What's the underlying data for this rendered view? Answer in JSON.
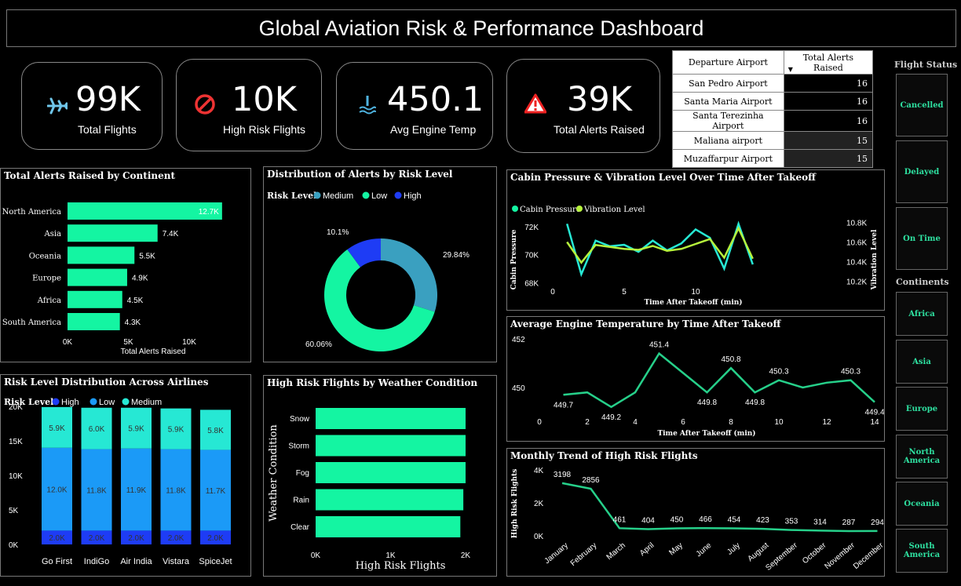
{
  "title": "Global Aviation Risk & Performance Dashboard",
  "kpis": [
    {
      "value": "99K",
      "label": "Total Flights",
      "icon": "airplane-icon"
    },
    {
      "value": "10K",
      "label": "High Risk Flights",
      "icon": "prohibited-icon"
    },
    {
      "value": "450.1",
      "label": "Avg Engine Temp",
      "icon": "thermometer-icon"
    },
    {
      "value": "39K",
      "label": "Total Alerts Raised",
      "icon": "warning-icon"
    }
  ],
  "airport_table": {
    "headers": [
      "Departure Airport",
      "Total Alerts Raised"
    ],
    "rows": [
      {
        "airport": "San Pedro Airport",
        "alerts": "16"
      },
      {
        "airport": "Santa Maria Airport",
        "alerts": "16"
      },
      {
        "airport": "Santa Terezinha Airport",
        "alerts": "16"
      },
      {
        "airport": "Maliana airport",
        "alerts": "15"
      },
      {
        "airport": "Muzaffarpur Airport",
        "alerts": "15"
      }
    ]
  },
  "flight_status": {
    "title": "Flight Status",
    "items": [
      "Cancelled",
      "Delayed",
      "On Time"
    ]
  },
  "continents": {
    "title": "Continents",
    "items": [
      "Africa",
      "Asia",
      "Europe",
      "North America",
      "Oceania",
      "South America"
    ]
  },
  "colors": {
    "green": "#14f5a2",
    "teal": "#3aa0c0",
    "blue": "#1e3cf5",
    "mid_blue": "#1b9af7",
    "cyan": "#26e8d4",
    "lime": "#b6f23c"
  },
  "chart_data": [
    {
      "id": "alerts_by_continent",
      "type": "bar",
      "orientation": "horizontal",
      "title": "Total Alerts Raised by Continent",
      "xlabel": "Total Alerts Raised",
      "categories": [
        "North America",
        "Asia",
        "Oceania",
        "Europe",
        "Africa",
        "South America"
      ],
      "values": [
        12700,
        7400,
        5500,
        4900,
        4500,
        4300
      ],
      "data_labels": [
        "12.7K",
        "7.4K",
        "5.5K",
        "4.9K",
        "4.5K",
        "4.3K"
      ],
      "xticks": [
        "0K",
        "5K",
        "10K"
      ],
      "xlim": [
        0,
        13000
      ]
    },
    {
      "id": "alerts_by_risk",
      "type": "pie",
      "title": "Distribution of Alerts by Risk Level",
      "legend_title": "Risk Level",
      "legend": [
        "Medium",
        "Low",
        "High"
      ],
      "slices": [
        {
          "name": "Medium",
          "value": 29.84,
          "label": "29.84%"
        },
        {
          "name": "Low",
          "value": 60.06,
          "label": "60.06%"
        },
        {
          "name": "High",
          "value": 10.1,
          "label": "10.1%"
        }
      ]
    },
    {
      "id": "cabin_pressure_vibration",
      "type": "line",
      "title": "Cabin Pressure & Vibration Level Over Time After Takeoff",
      "xlabel": "Time After Takeoff (min)",
      "ylabel": "Cabin Pressure",
      "y2label": "Vibration Level",
      "x": [
        1,
        2,
        3,
        4,
        5,
        6,
        7,
        8,
        9,
        10,
        11,
        12,
        13,
        14
      ],
      "series": [
        {
          "name": "Cabin Pressure",
          "values": [
            72200,
            68600,
            71000,
            70600,
            70700,
            70200,
            71000,
            70300,
            70800,
            71800,
            71200,
            69000,
            72200,
            69300
          ]
        },
        {
          "name": "Vibration Level",
          "values": [
            10.6,
            10.39,
            10.57,
            10.55,
            10.53,
            10.52,
            10.56,
            10.51,
            10.53,
            10.58,
            10.63,
            10.44,
            10.74,
            10.43
          ]
        }
      ],
      "yticks": [
        "68K",
        "70K",
        "72K"
      ],
      "ylim": [
        67400,
        73000
      ],
      "y2ticks": [
        "10.2K",
        "10.4K",
        "10.6K",
        "10.8K"
      ],
      "xticks": [
        "0",
        "5",
        "10"
      ],
      "xlim": [
        0,
        14.5
      ]
    },
    {
      "id": "avg_engine_temp",
      "type": "line",
      "title": "Average Engine Temperature by Time After Takeoff",
      "xlabel": "Time After Takeoff (min)",
      "x": [
        1,
        2,
        3,
        4,
        5,
        6,
        7,
        8,
        9,
        10,
        11,
        12,
        13,
        14
      ],
      "values": [
        449.7,
        449.8,
        449.2,
        449.8,
        451.4,
        450.6,
        449.8,
        450.8,
        449.8,
        450.3,
        450.0,
        450.2,
        450.3,
        449.4
      ],
      "point_labels": {
        "1": "449.7",
        "3": "449.2",
        "5": "451.4",
        "7": "449.8",
        "8": "450.8",
        "9": "449.8",
        "10": "450.3",
        "13": "450.3",
        "14": "449.4"
      },
      "yticks": [
        "450",
        "452"
      ],
      "xticks": [
        "0",
        "2",
        "4",
        "6",
        "8",
        "10",
        "12",
        "14"
      ],
      "xlim": [
        0,
        14
      ],
      "ylim": [
        448.4,
        452.4
      ]
    },
    {
      "id": "risk_by_airline",
      "type": "bar",
      "stacked": true,
      "title": "Risk Level Distribution Across Airlines",
      "legend_title": "Risk Level",
      "legend": [
        "High",
        "Low",
        "Medium"
      ],
      "categories": [
        "Go First",
        "IndiGo",
        "Air India",
        "Vistara",
        "SpiceJet"
      ],
      "series": [
        {
          "name": "High",
          "values": [
            2000,
            2000,
            2000,
            2000,
            2000
          ],
          "labels": [
            "2.0K",
            "2.0K",
            "2.0K",
            "2.0K",
            "2.0K"
          ]
        },
        {
          "name": "Low",
          "values": [
            12000,
            11800,
            11900,
            11800,
            11700
          ],
          "labels": [
            "12.0K",
            "11.8K",
            "11.9K",
            "11.8K",
            "11.7K"
          ]
        },
        {
          "name": "Medium",
          "values": [
            5900,
            6000,
            5900,
            5900,
            5800
          ],
          "labels": [
            "5.9K",
            "6.0K",
            "5.9K",
            "5.9K",
            "5.8K"
          ]
        }
      ],
      "yticks": [
        "0K",
        "5K",
        "10K",
        "15K",
        "20K"
      ],
      "ylim": [
        0,
        20000
      ]
    },
    {
      "id": "high_risk_by_weather",
      "type": "bar",
      "orientation": "horizontal",
      "title": "High Risk Flights by Weather Condition",
      "xlabel": "High Risk Flights",
      "ylabel": "Weather Condition",
      "categories": [
        "Snow",
        "Storm",
        "Fog",
        "Rain",
        "Clear"
      ],
      "values": [
        2020,
        2010,
        2000,
        1970,
        1930
      ],
      "xticks": [
        "0K",
        "1K",
        "2K"
      ],
      "xlim": [
        0,
        2000
      ]
    },
    {
      "id": "monthly_high_risk",
      "type": "line",
      "title": "Monthly Trend of High Risk Flights",
      "ylabel": "High Risk Flights",
      "categories": [
        "January",
        "February",
        "March",
        "April",
        "May",
        "June",
        "July",
        "August",
        "September",
        "October",
        "November",
        "December"
      ],
      "values": [
        3198,
        2856,
        461,
        404,
        450,
        466,
        454,
        423,
        353,
        314,
        287,
        294
      ],
      "data_labels": [
        "3198",
        "2856",
        "461",
        "404",
        "450",
        "466",
        "454",
        "423",
        "353",
        "314",
        "287",
        "294"
      ],
      "yticks": [
        "0K",
        "2K",
        "4K"
      ],
      "ylim": [
        0,
        4000
      ]
    }
  ]
}
